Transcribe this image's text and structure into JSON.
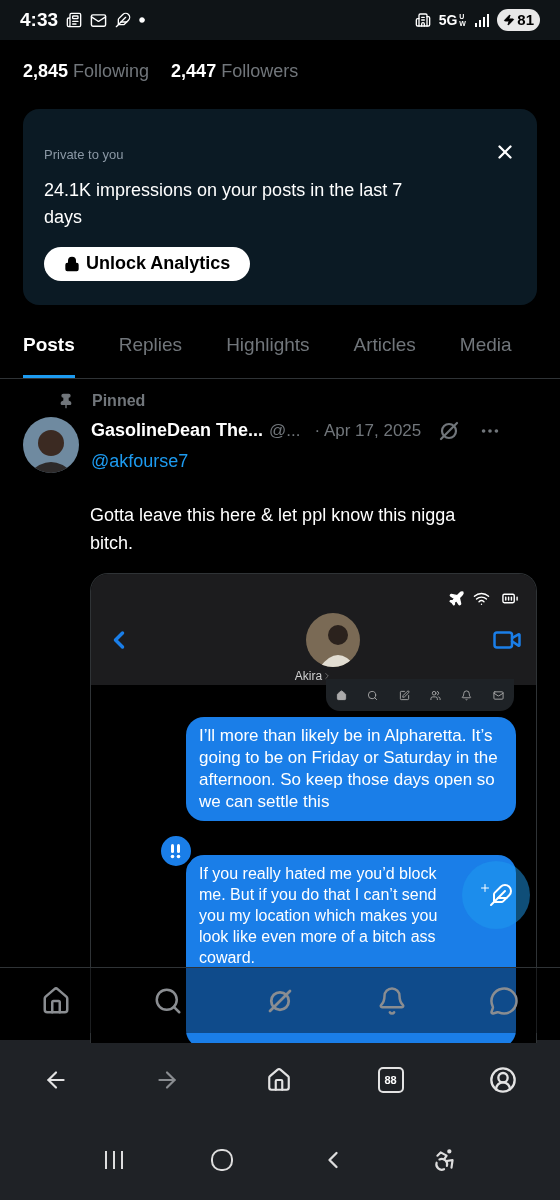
{
  "status_bar": {
    "time": "4:33",
    "network": "5G",
    "network_sub": "UW",
    "battery": "81"
  },
  "profile_stats": [
    {
      "count": "2,845",
      "label": "Following"
    },
    {
      "count": "2,447",
      "label": "Followers"
    }
  ],
  "analytics_card": {
    "caption": "Private to you",
    "text": "24.1K impressions on your posts in the last 7 days",
    "button": "Unlock Analytics"
  },
  "tabs": [
    {
      "label": "Posts",
      "selected": true
    },
    {
      "label": "Replies",
      "selected": false
    },
    {
      "label": "Highlights",
      "selected": false
    },
    {
      "label": "Articles",
      "selected": false
    },
    {
      "label": "Media",
      "selected": false
    }
  ],
  "pinned_post": {
    "pinned_label": "Pinned",
    "author_name": "GasolineDean The...",
    "author_handle": "@...",
    "date": "· Apr 17, 2025",
    "reply_to": "@akfourse7",
    "text": "Gotta leave this here & let ppl know this nigga bitch.",
    "attachment": {
      "contact_name": "Akira",
      "messages": [
        {
          "text": "I’ll more than likely be in Alpharetta. It’s going to be on Friday or Saturday in the afternoon. So keep those days open so we can settle this",
          "reaction": false
        },
        {
          "text": "If you really hated me you’d block me. But if you do that I can’t send you my location which makes you look like even more of a bitch ass coward.",
          "reaction": true
        }
      ]
    }
  },
  "browser_toolbar": {
    "tab_count": "88"
  }
}
